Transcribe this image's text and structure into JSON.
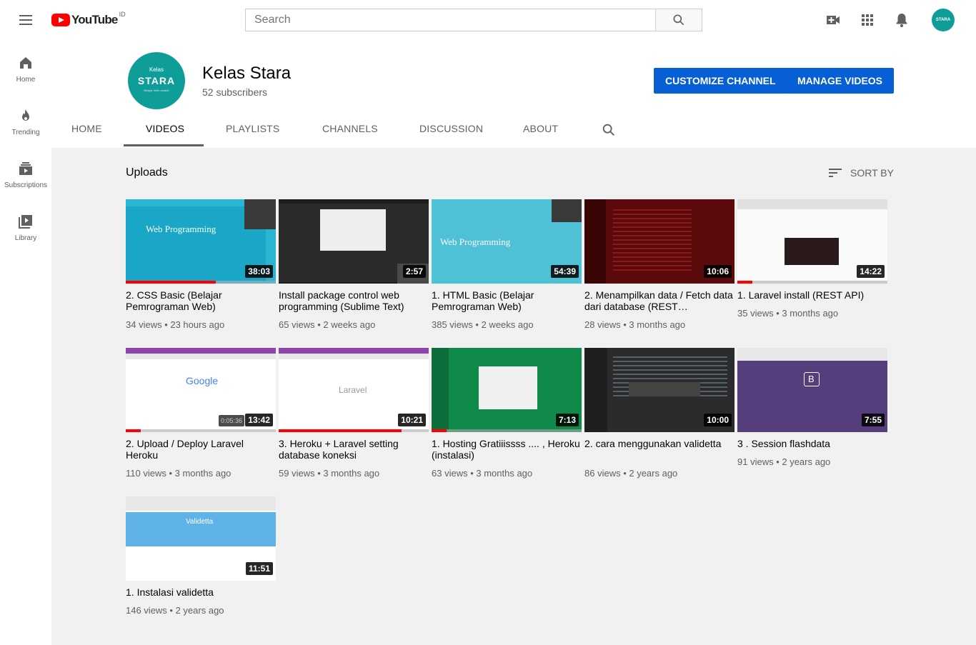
{
  "masthead": {
    "logo_text": "YouTube",
    "country_code": "ID",
    "search_placeholder": "Search",
    "icons": [
      "menu-icon",
      "search-icon",
      "create-video-icon",
      "apps-icon",
      "notifications-icon"
    ],
    "avatar_text": "STARA"
  },
  "guide": {
    "items": [
      {
        "label": "Home",
        "icon": "home-icon"
      },
      {
        "label": "Trending",
        "icon": "trending-icon"
      },
      {
        "label": "Subscriptions",
        "icon": "subscriptions-icon"
      },
      {
        "label": "Library",
        "icon": "library-icon"
      }
    ]
  },
  "channel": {
    "name": "Kelas Stara",
    "subscribers": "52 subscribers",
    "avatar_line1": "Kelas",
    "avatar_line2": "STARA",
    "avatar_line3": "Belajar lebih mudah",
    "customize_label": "CUSTOMIZE CHANNEL",
    "manage_label": "MANAGE VIDEOS"
  },
  "tabs": [
    "HOME",
    "VIDEOS",
    "PLAYLISTS",
    "CHANNELS",
    "DISCUSSION",
    "ABOUT"
  ],
  "active_tab": "VIDEOS",
  "section": {
    "title": "Uploads",
    "sort_label": "SORT BY"
  },
  "videos": [
    {
      "title": "2. CSS Basic (Belajar Pemrograman Web)",
      "views": "34 views",
      "age": "23 hours ago",
      "duration": "38:03",
      "watched": 0.6,
      "thumb_text": "Web Programming"
    },
    {
      "title": "Install package control web programming (Sublime Text)",
      "views": "65 views",
      "age": "2 weeks ago",
      "duration": "2:57",
      "watched": 0,
      "thumb_text": ""
    },
    {
      "title": "1. HTML Basic (Belajar Pemrograman Web)",
      "views": "385 views",
      "age": "2 weeks ago",
      "duration": "54:39",
      "watched": 0,
      "thumb_text": "Web Programming"
    },
    {
      "title": "2. Menampilkan data / Fetch data dari database (REST…",
      "views": "28 views",
      "age": "3 months ago",
      "duration": "10:06",
      "watched": 0,
      "thumb_text": ""
    },
    {
      "title": "1. Laravel install (REST API)",
      "views": "35 views",
      "age": "3 months ago",
      "duration": "14:22",
      "watched": 0.1,
      "thumb_text": ""
    },
    {
      "title": "2. Upload / Deploy Laravel Heroku",
      "views": "110 views",
      "age": "3 months ago",
      "duration": "13:42",
      "watched": 0.1,
      "resume": "0:05:36",
      "thumb_text": "Google"
    },
    {
      "title": "3. Heroku + Laravel setting database koneksi",
      "views": "59 views",
      "age": "3 months ago",
      "duration": "10:21",
      "watched": 0.82,
      "thumb_text": "Laravel"
    },
    {
      "title": "1. Hosting Gratiiissss .... , Heroku (instalasi)",
      "views": "63 views",
      "age": "3 months ago",
      "duration": "7:13",
      "watched": 0.1,
      "thumb_text": ""
    },
    {
      "title": "2. cara menggunakan validetta",
      "views": "86 views",
      "age": "2 years ago",
      "duration": "10:00",
      "watched": 0,
      "thumb_text": ""
    },
    {
      "title": "3 . Session flashdata",
      "views": "91 views",
      "age": "2 years ago",
      "duration": "7:55",
      "watched": 0,
      "thumb_text": "B"
    },
    {
      "title": "1. Instalasi validetta",
      "views": "146 views",
      "age": "2 years ago",
      "duration": "11:51",
      "watched": 0,
      "thumb_text": "Validetta"
    }
  ]
}
